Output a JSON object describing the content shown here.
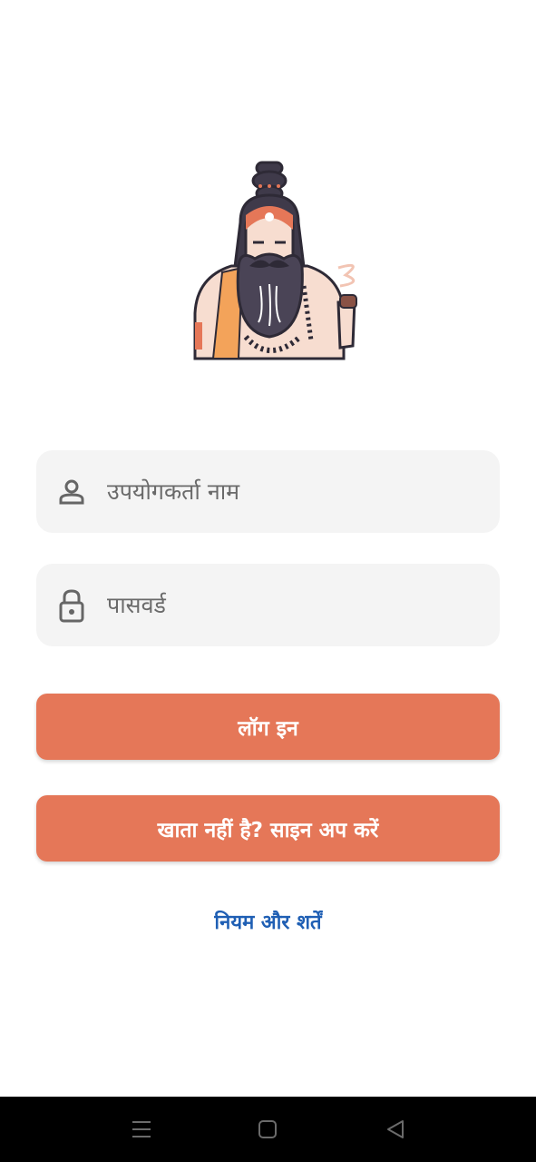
{
  "login_form": {
    "username_placeholder": "उपयोगकर्ता नाम",
    "password_placeholder": "पासवर्ड",
    "login_label": "लॉग इन",
    "signup_label": "खाता नहीं है? साइन अप करें",
    "terms_label": "नियम और शर्तें"
  },
  "icons": {
    "logo": "sadhu-mascot",
    "username": "person-icon",
    "password": "lock-icon",
    "nav_menu": "menu-icon",
    "nav_home": "home-icon",
    "nav_back": "back-icon"
  },
  "colors": {
    "accent": "#e57758",
    "link": "#1f5fb4",
    "field_bg": "#f4f4f4",
    "navbar_bg": "#000000"
  }
}
